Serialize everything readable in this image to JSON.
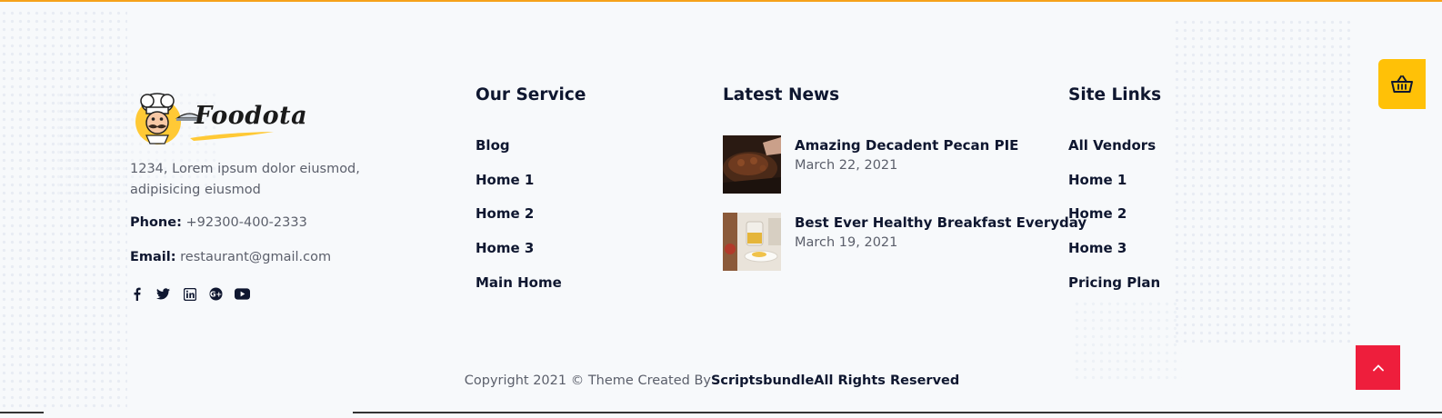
{
  "brand": {
    "name": "Foodota"
  },
  "contact": {
    "address": "1234, Lorem ipsum dolor eiusmod, adipisicing eiusmod",
    "phone_label": "Phone:",
    "phone": "+92300-400-2333",
    "email_label": "Email:",
    "email": "restaurant@gmail.com"
  },
  "social": [
    "facebook-icon",
    "twitter-icon",
    "linkedin-icon",
    "google-plus-icon",
    "youtube-icon"
  ],
  "services": {
    "title": "Our Service",
    "items": [
      "Blog",
      "Home 1",
      "Home 2",
      "Home 3",
      "Main Home"
    ]
  },
  "news": {
    "title": "Latest News",
    "items": [
      {
        "title": "Amazing Decadent Pecan PIE",
        "date": "March 22, 2021"
      },
      {
        "title": "Best Ever Healthy Breakfast Everyday",
        "date": "March 19, 2021"
      }
    ]
  },
  "site_links": {
    "title": "Site Links",
    "items": [
      "All Vendors",
      "Home 1",
      "Home 2",
      "Home 3",
      "Pricing Plan"
    ]
  },
  "copyright": {
    "prefix": "Copyright 2021 © Theme Created By",
    "brand": "Scriptsbundle",
    "suffix": "All Rights Reserved"
  },
  "colors": {
    "accent_top": "#f6a21a",
    "cart_button": "#ffc107",
    "scroll_top_button": "#ee1e3c",
    "heading": "#0f1730",
    "text": "#5b5f6b",
    "background": "#f7f9fb"
  }
}
